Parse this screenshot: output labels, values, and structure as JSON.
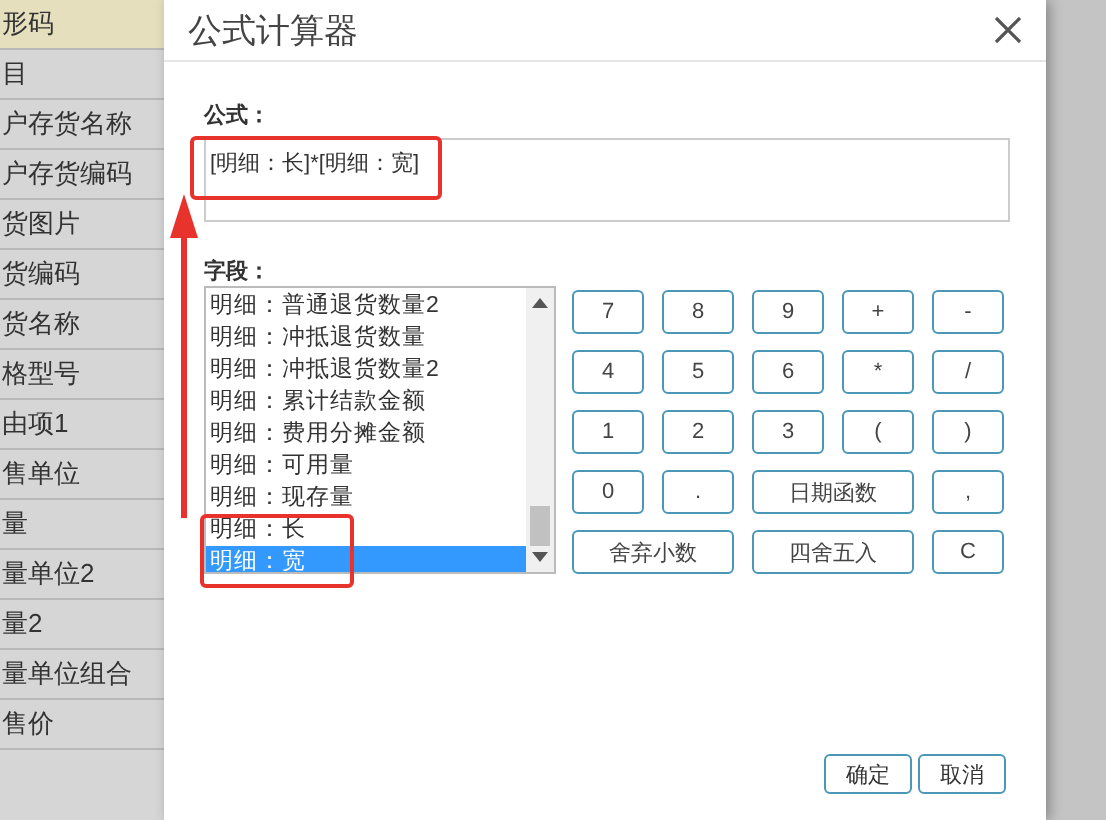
{
  "sidebar": {
    "items": [
      {
        "label": "形码",
        "selected": true
      },
      {
        "label": "目",
        "selected": false
      },
      {
        "label": "户存货名称",
        "selected": false
      },
      {
        "label": "户存货编码",
        "selected": false
      },
      {
        "label": "货图片",
        "selected": false
      },
      {
        "label": "货编码",
        "selected": false
      },
      {
        "label": "货名称",
        "selected": false
      },
      {
        "label": "格型号",
        "selected": false
      },
      {
        "label": "由项1",
        "selected": false
      },
      {
        "label": "售单位",
        "selected": false
      },
      {
        "label": "量",
        "selected": false
      },
      {
        "label": "量单位2",
        "selected": false
      },
      {
        "label": "量2",
        "selected": false
      },
      {
        "label": "量单位组合",
        "selected": false
      },
      {
        "label": "售价",
        "selected": false
      }
    ]
  },
  "dialog": {
    "title": "公式计算器",
    "formula_label": "公式：",
    "formula": "[明细：长]*[明细：宽]",
    "fields_label": "字段：",
    "fields": [
      {
        "label": "明细：普通退货数量2",
        "selected": false
      },
      {
        "label": "明细：冲抵退货数量",
        "selected": false
      },
      {
        "label": "明细：冲抵退货数量2",
        "selected": false
      },
      {
        "label": "明细：累计结款金额",
        "selected": false
      },
      {
        "label": "明细：费用分摊金额",
        "selected": false
      },
      {
        "label": "明细：可用量",
        "selected": false
      },
      {
        "label": "明细：现存量",
        "selected": false
      },
      {
        "label": "明细：长",
        "selected": false
      },
      {
        "label": "明细：宽",
        "selected": true
      }
    ],
    "keypad": [
      {
        "label": "7",
        "kind": "normal"
      },
      {
        "label": "8",
        "kind": "normal"
      },
      {
        "label": "9",
        "kind": "normal"
      },
      {
        "label": "+",
        "kind": "normal"
      },
      {
        "label": "-",
        "kind": "normal"
      },
      {
        "label": "4",
        "kind": "normal"
      },
      {
        "label": "5",
        "kind": "normal"
      },
      {
        "label": "6",
        "kind": "normal"
      },
      {
        "label": "*",
        "kind": "normal"
      },
      {
        "label": "/",
        "kind": "normal"
      },
      {
        "label": "1",
        "kind": "normal"
      },
      {
        "label": "2",
        "kind": "normal"
      },
      {
        "label": "3",
        "kind": "normal"
      },
      {
        "label": "(",
        "kind": "normal"
      },
      {
        "label": ")",
        "kind": "normal"
      },
      {
        "label": "0",
        "kind": "normal"
      },
      {
        "label": ".",
        "kind": "normal"
      },
      {
        "label": "日期函数",
        "kind": "wide"
      },
      {
        "label": ",",
        "kind": "normal"
      },
      {
        "label": "舍弃小数",
        "kind": "wide"
      },
      {
        "label": "四舍五入",
        "kind": "wide"
      },
      {
        "label": "C",
        "kind": "normal"
      }
    ],
    "buttons": [
      "确定",
      "取消"
    ]
  }
}
